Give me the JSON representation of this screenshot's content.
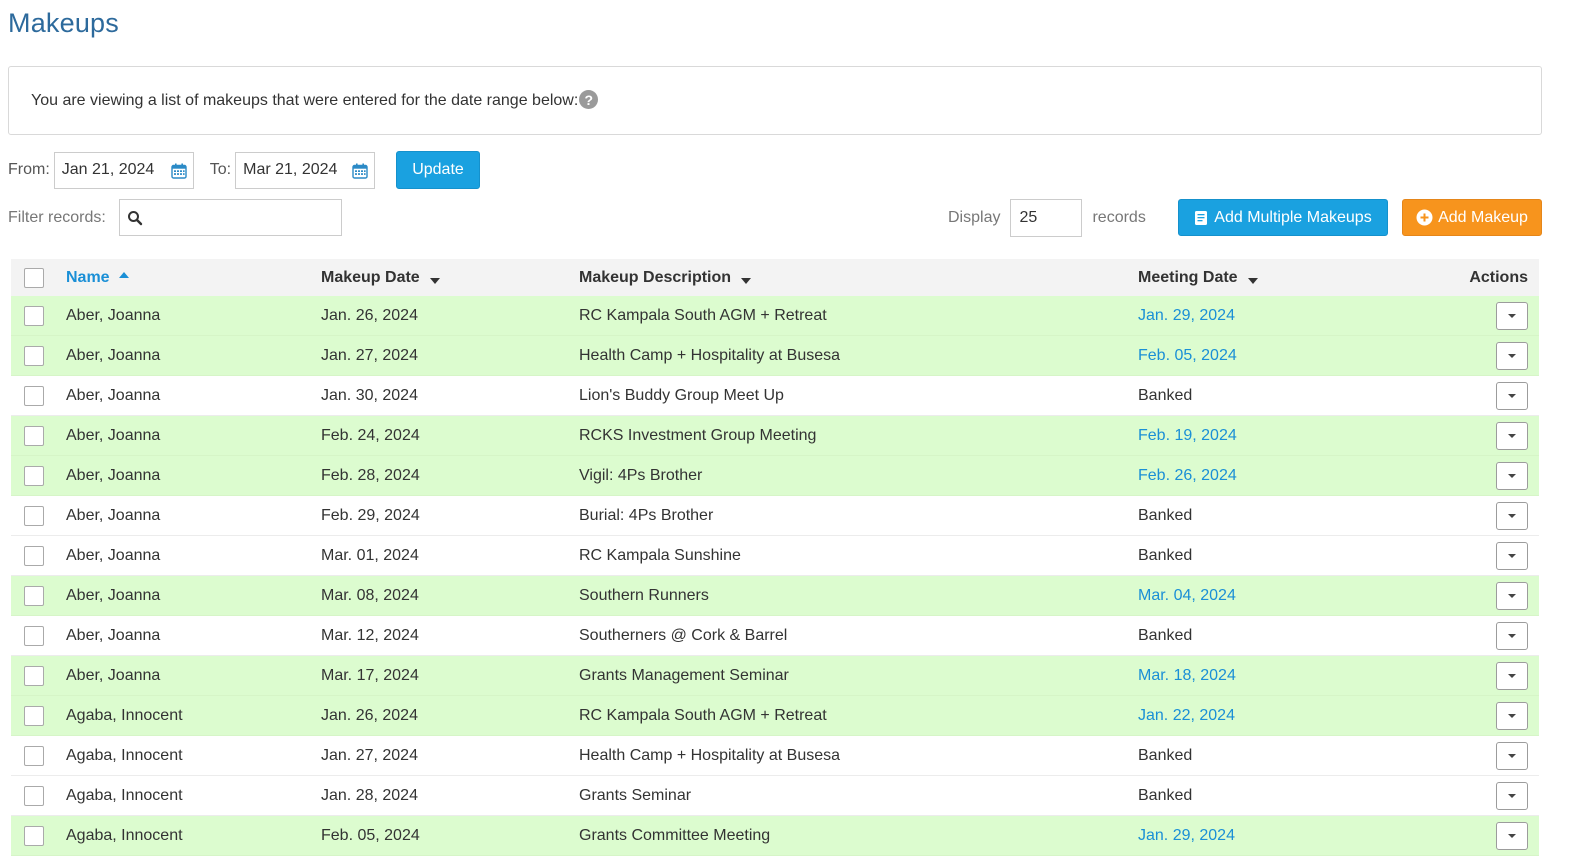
{
  "page": {
    "title": "Makeups",
    "info_text": "You are viewing a list of makeups that were entered for the date range below:"
  },
  "filters": {
    "from_label": "From:",
    "from_value": "Jan 21, 2024",
    "to_label": "To:",
    "to_value": "Mar 21, 2024",
    "update_label": "Update",
    "filter_label": "Filter records:",
    "filter_value": "",
    "display_label": "Display",
    "display_value": "25",
    "records_label": "records"
  },
  "buttons": {
    "add_multiple": "Add Multiple Makeups",
    "add_makeup": "Add Makeup"
  },
  "table": {
    "headers": {
      "name": "Name",
      "makeup_date": "Makeup Date",
      "description": "Makeup Description",
      "meeting_date": "Meeting Date",
      "actions": "Actions"
    },
    "rows": [
      {
        "name": "Aber, Joanna",
        "makeup_date": "Jan. 26, 2024",
        "description": "RC Kampala South AGM + Retreat",
        "meeting_date": "Jan. 29, 2024",
        "status": "green"
      },
      {
        "name": "Aber, Joanna",
        "makeup_date": "Jan. 27, 2024",
        "description": "Health Camp + Hospitality at Busesa",
        "meeting_date": "Feb. 05, 2024",
        "status": "green"
      },
      {
        "name": "Aber, Joanna",
        "makeup_date": "Jan. 30, 2024",
        "description": "Lion's Buddy Group Meet Up",
        "meeting_date": "Banked",
        "status": "banked"
      },
      {
        "name": "Aber, Joanna",
        "makeup_date": "Feb. 24, 2024",
        "description": "RCKS Investment Group Meeting",
        "meeting_date": "Feb. 19, 2024",
        "status": "green"
      },
      {
        "name": "Aber, Joanna",
        "makeup_date": "Feb. 28, 2024",
        "description": "Vigil: 4Ps Brother",
        "meeting_date": "Feb. 26, 2024",
        "status": "green"
      },
      {
        "name": "Aber, Joanna",
        "makeup_date": "Feb. 29, 2024",
        "description": "Burial: 4Ps Brother",
        "meeting_date": "Banked",
        "status": "banked"
      },
      {
        "name": "Aber, Joanna",
        "makeup_date": "Mar. 01, 2024",
        "description": "RC Kampala Sunshine",
        "meeting_date": "Banked",
        "status": "banked"
      },
      {
        "name": "Aber, Joanna",
        "makeup_date": "Mar. 08, 2024",
        "description": "Southern Runners",
        "meeting_date": "Mar. 04, 2024",
        "status": "green"
      },
      {
        "name": "Aber, Joanna",
        "makeup_date": "Mar. 12, 2024",
        "description": "Southerners @ Cork & Barrel",
        "meeting_date": "Banked",
        "status": "banked"
      },
      {
        "name": "Aber, Joanna",
        "makeup_date": "Mar. 17, 2024",
        "description": "Grants Management Seminar",
        "meeting_date": "Mar. 18, 2024",
        "status": "green"
      },
      {
        "name": "Agaba, Innocent",
        "makeup_date": "Jan. 26, 2024",
        "description": "RC Kampala South AGM + Retreat",
        "meeting_date": "Jan. 22, 2024",
        "status": "green"
      },
      {
        "name": "Agaba, Innocent",
        "makeup_date": "Jan. 27, 2024",
        "description": "Health Camp + Hospitality at Busesa",
        "meeting_date": "Banked",
        "status": "banked"
      },
      {
        "name": "Agaba, Innocent",
        "makeup_date": "Jan. 28, 2024",
        "description": "Grants Seminar",
        "meeting_date": "Banked",
        "status": "banked"
      },
      {
        "name": "Agaba, Innocent",
        "makeup_date": "Feb. 05, 2024",
        "description": "Grants Committee Meeting",
        "meeting_date": "Jan. 29, 2024",
        "status": "green"
      }
    ]
  },
  "icons": {
    "help": "question-circle-icon",
    "calendar": "calendar-icon",
    "search": "search-icon",
    "add_multiple": "document-icon",
    "add": "plus-circle-icon"
  },
  "colors": {
    "title": "#2d6a9c",
    "link": "#1a8fd6",
    "primary_button": "#1aa1e0",
    "orange_button": "#f7941d",
    "row_highlight": "#dcfccf"
  }
}
